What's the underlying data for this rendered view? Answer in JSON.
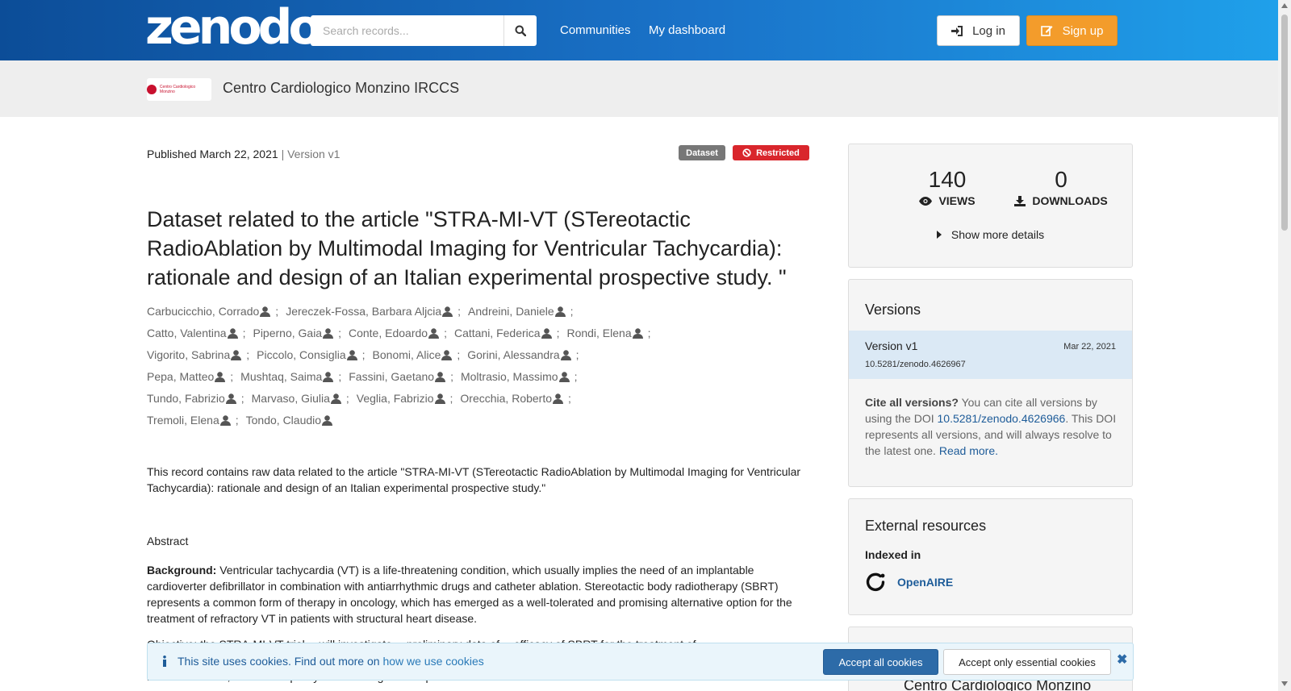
{
  "header": {
    "logo_text": "zenodo",
    "search_placeholder": "Search records...",
    "nav": [
      "Communities",
      "My dashboard"
    ],
    "login_label": "Log in",
    "signup_label": "Sign up"
  },
  "community": {
    "logo_text": "Centro Cardiologico Monzino",
    "title": "Centro Cardiologico Monzino IRCCS"
  },
  "record": {
    "published_label": "Published March 22, 2021",
    "version_label": "| Version v1",
    "badges": {
      "type": "Dataset",
      "access": "Restricted"
    },
    "title": "Dataset related to the article \"STRA-MI-VT (STereotactic RadioAblation by Multimodal Imaging for Ventricular Tachycardia): rationale and design of an Italian experimental prospective study. \"",
    "creator_rows": [
      [
        "Carbucicchio, Corrado",
        "Jereczek-Fossa, Barbara Aljcia",
        "Andreini, Daniele"
      ],
      [
        "Catto, Valentina",
        "Piperno, Gaia",
        "Conte, Edoardo",
        "Cattani, Federica",
        "Rondi, Elena"
      ],
      [
        "Vigorito, Sabrina",
        "Piccolo, Consiglia",
        "Bonomi, Alice",
        "Gorini, Alessandra"
      ],
      [
        "Pepa, Matteo",
        "Mushtaq, Saima",
        "Fassini, Gaetano",
        "Moltrasio, Massimo"
      ],
      [
        "Tundo, Fabrizio",
        "Marvaso, Giulia",
        "Veglia, Fabrizio",
        "Orecchia, Roberto"
      ],
      [
        "Tremoli, Elena",
        "Tondo, Claudio"
      ]
    ],
    "description": "This record contains raw data related to the article \"STRA-MI-VT (STereotactic RadioAblation by Multimodal Imaging for Ventricular Tachycardia): rationale and design of an Italian experimental prospective study.\"",
    "abstract_heading": "Abstract",
    "background_label": "Background:",
    "background_text": " Ventricular tachycardia (VT) is a life-threatening condition, which usually implies the need of an implantable cardioverter defibrillator in combination with antiarrhythmic drugs and catheter ablation. Stereotactic body radiotherapy (SBRT) represents a common form of therapy in oncology, which has emerged as a well-tolerated and promising alternative option for the treatment of refractory VT in patients with structural heart disease.",
    "objective_partial": "Objective: the STRA-MI-VT trial… will investigate… preliminary data of… efficacy of SBRT for the treatment of…",
    "objective_tail": "in heart function, and in the quality of life during follow-up."
  },
  "sidebar": {
    "stats": {
      "views": "140",
      "views_label": "VIEWS",
      "downloads": "0",
      "downloads_label": "DOWNLOADS",
      "more": "Show more details"
    },
    "versions": {
      "heading": "Versions",
      "active": {
        "name": "Version v1",
        "date": "Mar 22, 2021",
        "doi": "10.5281/zenodo.4626967"
      },
      "cite_bold": "Cite all versions?",
      "cite_text1": " You can cite all versions by using the DOI ",
      "cite_doi": "10.5281/zenodo.4626966",
      "cite_text2": ". This DOI represents all versions, and will always resolve to the latest one. ",
      "read_more": "Read more."
    },
    "external": {
      "heading": "External resources",
      "indexed_in": "Indexed in",
      "openaire": "OpenAIRE"
    },
    "panel4_title": "Centro Cardiologico Monzino"
  },
  "cookie": {
    "text": "This site uses cookies. Find out more on ",
    "link": "how we use cookies",
    "accept_all": "Accept all cookies",
    "accept_essential": "Accept only essential cookies"
  },
  "colors": {
    "accent": "#1e5c99",
    "signup": "#f39c2b",
    "restricted": "#d9262c",
    "header_start": "#0c4d98",
    "header_end": "#1fa0ea"
  }
}
